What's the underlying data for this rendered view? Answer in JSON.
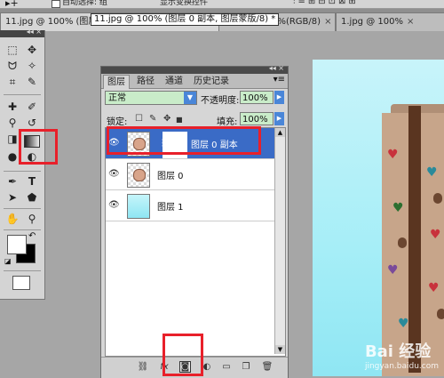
{
  "options_bar": {
    "tool_glyph": "▸+",
    "partial_label_1": "自动选择: 组",
    "partial_label_2": "显示变换控件",
    "align_symbols": "⫶≡⊞⊟⊡⊠⊞"
  },
  "doc_tabs": [
    {
      "label": "11.jpg @ 100% (图层 0 副本, 图层蒙版/8) *",
      "close": "×"
    },
    {
      "label": "6.jpg @ 100%(RGB/8)",
      "close": "×"
    },
    {
      "label": "1.jpg @ 100%",
      "close": "×"
    }
  ],
  "tooltip": "11.jpg @ 100% (图层 0 副本, 图层蒙版/8) *",
  "toolbox": {
    "collapse_glyph": "◂◂ ×",
    "tools": [
      {
        "name": "marquee-icon",
        "glyph": "⬚"
      },
      {
        "name": "move-icon",
        "glyph": "✥"
      },
      {
        "name": "lasso-icon",
        "glyph": "ᗢ"
      },
      {
        "name": "magic-wand-icon",
        "glyph": "✧"
      },
      {
        "name": "crop-icon",
        "glyph": "⌗"
      },
      {
        "name": "eyedropper-icon",
        "glyph": "✎"
      },
      {
        "name": "healing-brush-icon",
        "glyph": "✚"
      },
      {
        "name": "brush-icon",
        "glyph": "✐"
      },
      {
        "name": "clone-stamp-icon",
        "glyph": "⚲"
      },
      {
        "name": "history-brush-icon",
        "glyph": "↺"
      },
      {
        "name": "eraser-icon",
        "glyph": "◨"
      },
      {
        "name": "gradient-icon",
        "glyph": "▭"
      },
      {
        "name": "blur-icon",
        "glyph": "●"
      },
      {
        "name": "dodge-icon",
        "glyph": "◐"
      },
      {
        "name": "pen-icon",
        "glyph": "✒"
      },
      {
        "name": "type-icon",
        "glyph": "T"
      },
      {
        "name": "path-select-icon",
        "glyph": "➤"
      },
      {
        "name": "shape-icon",
        "glyph": "⬟"
      },
      {
        "name": "hand-icon",
        "glyph": "✋"
      },
      {
        "name": "zoom-icon",
        "glyph": "⚲"
      }
    ],
    "fg_color": "#ffffff",
    "bg_color": "#000000",
    "swap_glyph": "↶",
    "default_glyph": "◪"
  },
  "layers_panel": {
    "collapse_glyph": "◂◂ ×",
    "tabs": [
      "图层",
      "路径",
      "通道",
      "历史记录"
    ],
    "menu_glyph": "▾≡",
    "blend_mode": "正常",
    "opacity_label": "不透明度:",
    "opacity_value": "100%",
    "lock_label": "锁定:",
    "lock_icons": [
      "☐",
      "✎",
      "✥",
      "🔒"
    ],
    "fill_label": "填充:",
    "fill_value": "100%",
    "layers": [
      {
        "name": "图层 0 副本",
        "selected": true,
        "has_mask": true
      },
      {
        "name": "图层 0",
        "selected": false,
        "has_mask": false
      },
      {
        "name": "图层 1",
        "selected": false,
        "has_mask": false
      }
    ],
    "footer_icons": [
      {
        "name": "link-layers-icon",
        "glyph": "⛓"
      },
      {
        "name": "layer-style-icon",
        "glyph": "fx"
      },
      {
        "name": "add-mask-icon",
        "glyph": "◙"
      },
      {
        "name": "adjustment-layer-icon",
        "glyph": "◐"
      },
      {
        "name": "new-group-icon",
        "glyph": "▭"
      },
      {
        "name": "new-layer-icon",
        "glyph": "❐"
      },
      {
        "name": "delete-layer-icon",
        "glyph": "🗑"
      }
    ]
  },
  "watermark": {
    "text": "Bai 经验",
    "sub": "jingyan.baidu.com"
  },
  "colors": {
    "highlight": "#e8202a",
    "selection": "#3a6bc6",
    "field_bg": "#c9ecc9"
  }
}
